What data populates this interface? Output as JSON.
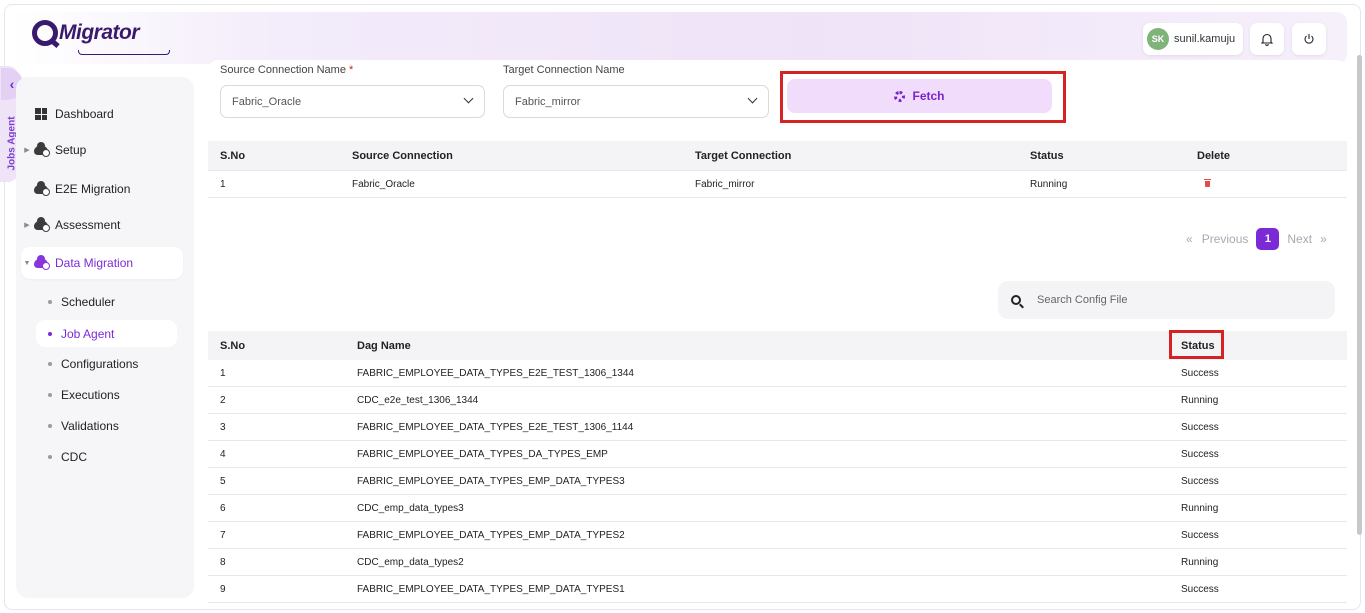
{
  "app": {
    "logo_text": "Migrator"
  },
  "header": {
    "user_initials": "SK",
    "user_name": "sunil.kamuju"
  },
  "side_tab": {
    "label": "Jobs Agent"
  },
  "sidebar": {
    "items": [
      {
        "label": "Dashboard"
      },
      {
        "label": "Setup"
      },
      {
        "label": "E2E Migration"
      },
      {
        "label": "Assessment"
      },
      {
        "label": "Data Migration"
      }
    ],
    "sub_items": [
      {
        "label": "Scheduler"
      },
      {
        "label": "Job Agent"
      },
      {
        "label": "Configurations"
      },
      {
        "label": "Executions"
      },
      {
        "label": "Validations"
      },
      {
        "label": "CDC"
      }
    ]
  },
  "form": {
    "source_label": "Source Connection Name",
    "required_mark": "*",
    "source_value": "Fabric_Oracle",
    "target_label": "Target Connection Name",
    "target_value": "Fabric_mirror",
    "fetch_label": "Fetch"
  },
  "connections_table": {
    "headers": [
      "S.No",
      "Source Connection",
      "Target Connection",
      "Status",
      "Delete"
    ],
    "rows": [
      {
        "sno": "1",
        "source": "Fabric_Oracle",
        "target": "Fabric_mirror",
        "status": "Running"
      }
    ]
  },
  "pagination": {
    "prev": "Previous",
    "page": "1",
    "next": "Next",
    "first": "«",
    "last": "»"
  },
  "search": {
    "placeholder": "Search Config File"
  },
  "dag_table": {
    "headers": [
      "S.No",
      "Dag Name",
      "Status"
    ],
    "rows": [
      {
        "sno": "1",
        "name": "FABRIC_EMPLOYEE_DATA_TYPES_E2E_TEST_1306_1344",
        "status": "Success"
      },
      {
        "sno": "2",
        "name": "CDC_e2e_test_1306_1344",
        "status": "Running"
      },
      {
        "sno": "3",
        "name": "FABRIC_EMPLOYEE_DATA_TYPES_E2E_TEST_1306_1144",
        "status": "Success"
      },
      {
        "sno": "4",
        "name": "FABRIC_EMPLOYEE_DATA_TYPES_DA_TYPES_EMP",
        "status": "Success"
      },
      {
        "sno": "5",
        "name": "FABRIC_EMPLOYEE_DATA_TYPES_EMP_DATA_TYPES3",
        "status": "Success"
      },
      {
        "sno": "6",
        "name": "CDC_emp_data_types3",
        "status": "Running"
      },
      {
        "sno": "7",
        "name": "FABRIC_EMPLOYEE_DATA_TYPES_EMP_DATA_TYPES2",
        "status": "Success"
      },
      {
        "sno": "8",
        "name": "CDC_emp_data_types2",
        "status": "Running"
      },
      {
        "sno": "9",
        "name": "FABRIC_EMPLOYEE_DATA_TYPES_EMP_DATA_TYPES1",
        "status": "Success"
      }
    ]
  },
  "colors": {
    "accent": "#7c2ad6",
    "highlight": "#d42323",
    "fetch_bg": "#f1dcfb"
  }
}
